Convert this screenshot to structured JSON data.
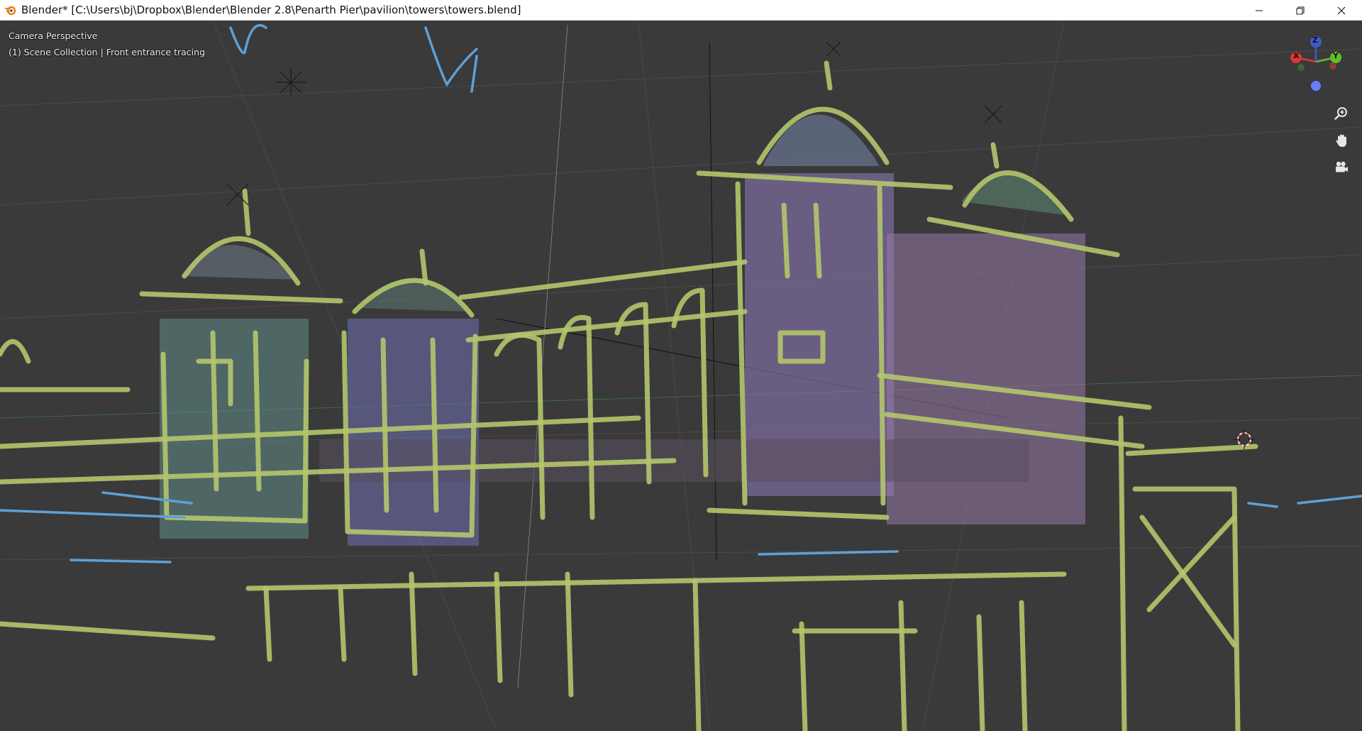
{
  "window": {
    "title": "Blender* [C:\\Users\\bj\\Dropbox\\Blender\\Blender 2.8\\Penarth Pier\\pavilion\\towers\\towers.blend]"
  },
  "viewport": {
    "view_label": "Camera Perspective",
    "collection_label": "(1) Scene Collection | Front entrance tracing"
  },
  "gizmo": {
    "x_label": "X",
    "y_label": "Y",
    "z_label": "Z",
    "colors": {
      "x": "#e2323a",
      "y": "#5ec126",
      "z": "#3d5cc9",
      "neg": "#6a7cff"
    }
  },
  "colors": {
    "stroke": "#b4c76c",
    "accent_blue": "#5ea0d6",
    "tower_purple": "#8a74b3",
    "tower_teal": "#5f8b86"
  },
  "icons": {
    "zoom": "zoom-icon",
    "pan": "hand-icon",
    "camera": "camera-icon"
  }
}
